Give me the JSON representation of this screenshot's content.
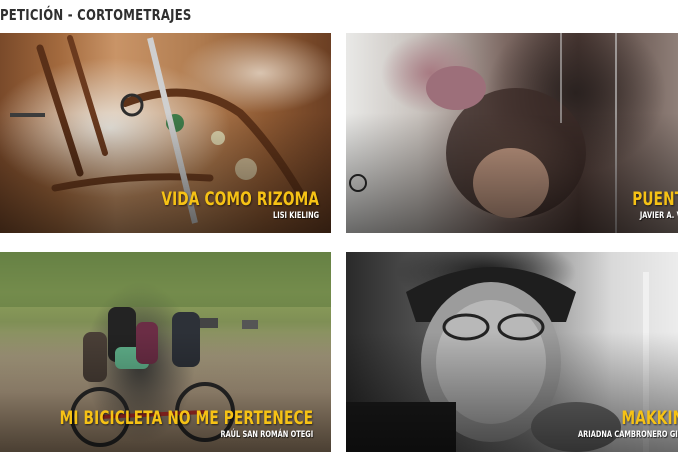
{
  "section": {
    "title": "PETICIÓN - CORTOMETRAJES"
  },
  "films": [
    {
      "title": "VIDA COMO RIZOMA",
      "director": "LISI KIELING"
    },
    {
      "title": "PUENT",
      "director": "JAVIER A. VI"
    },
    {
      "title": "MI BICICLETA NO ME PERTENECE",
      "director": "RAÚL SAN ROMÁN OTEGI"
    },
    {
      "title": "MAKKIN",
      "director": "ARIADNA CAMBRONERO GIM"
    }
  ],
  "colors": {
    "title_accent": "#f6c215",
    "director_text": "#ffffff",
    "heading": "#2f2f2f"
  }
}
